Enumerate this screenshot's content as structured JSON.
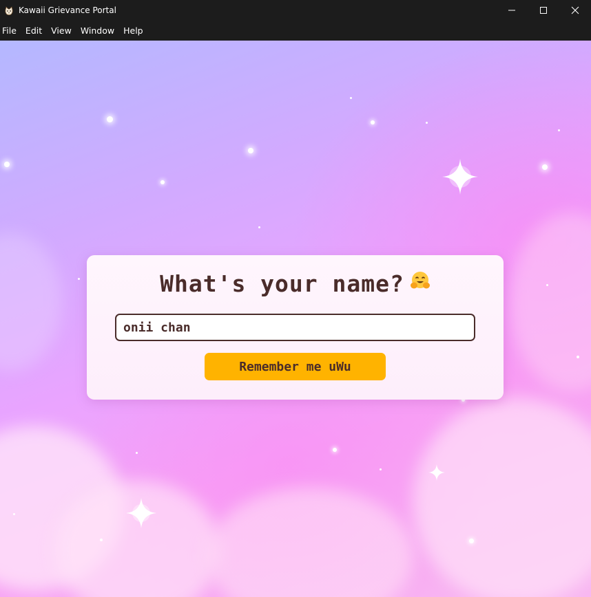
{
  "window": {
    "title": "Kawaii Grievance Portal",
    "app_icon": "cat-face-icon",
    "controls": [
      "minimize-icon",
      "maximize-icon",
      "close-icon"
    ]
  },
  "menu": {
    "items": [
      "File",
      "Edit",
      "View",
      "Window",
      "Help"
    ]
  },
  "card": {
    "heading": "What's your name?",
    "heading_emoji": "hugging-face-icon",
    "name_input": {
      "value": "onii chan",
      "placeholder": ""
    },
    "submit_label": "Remember me uWu"
  },
  "colors": {
    "titlebar": "#1c1c1c",
    "text_dark": "#4a2c2a",
    "button": "#ffb300",
    "card": "#fff6fd"
  }
}
